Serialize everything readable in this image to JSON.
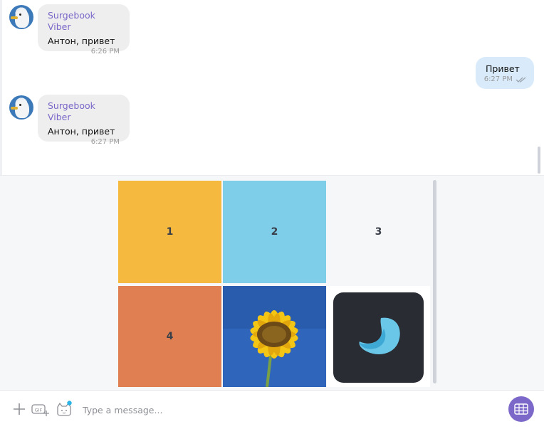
{
  "messages": [
    {
      "sender": "Surgebook Viber",
      "text": "Антон, привет",
      "time": "6:26 PM"
    },
    {
      "text": "Привет",
      "time": "6:27 PM",
      "outgoing": true,
      "status_icon": "double-check-icon"
    },
    {
      "sender": "Surgebook Viber",
      "text": "Антон, привет",
      "time": "6:27 PM"
    }
  ],
  "sticker_grid": {
    "tiles": [
      {
        "label": "1",
        "color": "#f5b940"
      },
      {
        "label": "2",
        "color": "#7ecde9"
      },
      {
        "label": "3",
        "color": "#f6f7f9"
      },
      {
        "label": "4",
        "color": "#e08052"
      },
      {
        "label": "",
        "image": "sunflower"
      },
      {
        "label": "",
        "image": "app-logo"
      }
    ]
  },
  "input": {
    "placeholder": "Type a message...",
    "icons": [
      "plus-icon",
      "gif-icon",
      "sticker-icon"
    ],
    "send_icon": "grid-icon"
  },
  "colors": {
    "accent": "#7b68c9",
    "incoming_bubble": "#eeeeee",
    "outgoing_bubble": "#d9ebfa"
  }
}
